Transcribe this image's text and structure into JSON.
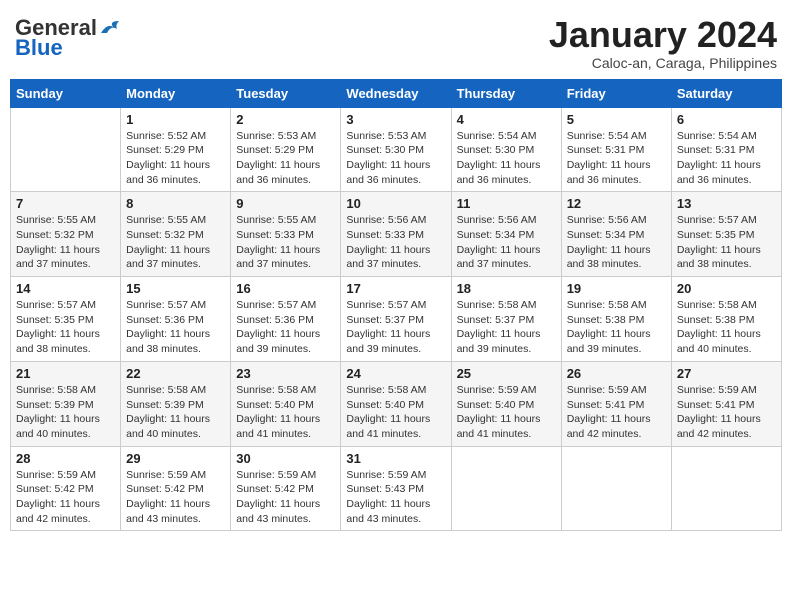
{
  "header": {
    "logo_line1": "General",
    "logo_line2": "Blue",
    "title": "January 2024",
    "subtitle": "Caloc-an, Caraga, Philippines"
  },
  "days_of_week": [
    "Sunday",
    "Monday",
    "Tuesday",
    "Wednesday",
    "Thursday",
    "Friday",
    "Saturday"
  ],
  "weeks": [
    [
      {
        "day": "",
        "info": ""
      },
      {
        "day": "1",
        "info": "Sunrise: 5:52 AM\nSunset: 5:29 PM\nDaylight: 11 hours\nand 36 minutes."
      },
      {
        "day": "2",
        "info": "Sunrise: 5:53 AM\nSunset: 5:29 PM\nDaylight: 11 hours\nand 36 minutes."
      },
      {
        "day": "3",
        "info": "Sunrise: 5:53 AM\nSunset: 5:30 PM\nDaylight: 11 hours\nand 36 minutes."
      },
      {
        "day": "4",
        "info": "Sunrise: 5:54 AM\nSunset: 5:30 PM\nDaylight: 11 hours\nand 36 minutes."
      },
      {
        "day": "5",
        "info": "Sunrise: 5:54 AM\nSunset: 5:31 PM\nDaylight: 11 hours\nand 36 minutes."
      },
      {
        "day": "6",
        "info": "Sunrise: 5:54 AM\nSunset: 5:31 PM\nDaylight: 11 hours\nand 36 minutes."
      }
    ],
    [
      {
        "day": "7",
        "info": "Sunrise: 5:55 AM\nSunset: 5:32 PM\nDaylight: 11 hours\nand 37 minutes."
      },
      {
        "day": "8",
        "info": "Sunrise: 5:55 AM\nSunset: 5:32 PM\nDaylight: 11 hours\nand 37 minutes."
      },
      {
        "day": "9",
        "info": "Sunrise: 5:55 AM\nSunset: 5:33 PM\nDaylight: 11 hours\nand 37 minutes."
      },
      {
        "day": "10",
        "info": "Sunrise: 5:56 AM\nSunset: 5:33 PM\nDaylight: 11 hours\nand 37 minutes."
      },
      {
        "day": "11",
        "info": "Sunrise: 5:56 AM\nSunset: 5:34 PM\nDaylight: 11 hours\nand 37 minutes."
      },
      {
        "day": "12",
        "info": "Sunrise: 5:56 AM\nSunset: 5:34 PM\nDaylight: 11 hours\nand 38 minutes."
      },
      {
        "day": "13",
        "info": "Sunrise: 5:57 AM\nSunset: 5:35 PM\nDaylight: 11 hours\nand 38 minutes."
      }
    ],
    [
      {
        "day": "14",
        "info": "Sunrise: 5:57 AM\nSunset: 5:35 PM\nDaylight: 11 hours\nand 38 minutes."
      },
      {
        "day": "15",
        "info": "Sunrise: 5:57 AM\nSunset: 5:36 PM\nDaylight: 11 hours\nand 38 minutes."
      },
      {
        "day": "16",
        "info": "Sunrise: 5:57 AM\nSunset: 5:36 PM\nDaylight: 11 hours\nand 39 minutes."
      },
      {
        "day": "17",
        "info": "Sunrise: 5:57 AM\nSunset: 5:37 PM\nDaylight: 11 hours\nand 39 minutes."
      },
      {
        "day": "18",
        "info": "Sunrise: 5:58 AM\nSunset: 5:37 PM\nDaylight: 11 hours\nand 39 minutes."
      },
      {
        "day": "19",
        "info": "Sunrise: 5:58 AM\nSunset: 5:38 PM\nDaylight: 11 hours\nand 39 minutes."
      },
      {
        "day": "20",
        "info": "Sunrise: 5:58 AM\nSunset: 5:38 PM\nDaylight: 11 hours\nand 40 minutes."
      }
    ],
    [
      {
        "day": "21",
        "info": "Sunrise: 5:58 AM\nSunset: 5:39 PM\nDaylight: 11 hours\nand 40 minutes."
      },
      {
        "day": "22",
        "info": "Sunrise: 5:58 AM\nSunset: 5:39 PM\nDaylight: 11 hours\nand 40 minutes."
      },
      {
        "day": "23",
        "info": "Sunrise: 5:58 AM\nSunset: 5:40 PM\nDaylight: 11 hours\nand 41 minutes."
      },
      {
        "day": "24",
        "info": "Sunrise: 5:58 AM\nSunset: 5:40 PM\nDaylight: 11 hours\nand 41 minutes."
      },
      {
        "day": "25",
        "info": "Sunrise: 5:59 AM\nSunset: 5:40 PM\nDaylight: 11 hours\nand 41 minutes."
      },
      {
        "day": "26",
        "info": "Sunrise: 5:59 AM\nSunset: 5:41 PM\nDaylight: 11 hours\nand 42 minutes."
      },
      {
        "day": "27",
        "info": "Sunrise: 5:59 AM\nSunset: 5:41 PM\nDaylight: 11 hours\nand 42 minutes."
      }
    ],
    [
      {
        "day": "28",
        "info": "Sunrise: 5:59 AM\nSunset: 5:42 PM\nDaylight: 11 hours\nand 42 minutes."
      },
      {
        "day": "29",
        "info": "Sunrise: 5:59 AM\nSunset: 5:42 PM\nDaylight: 11 hours\nand 43 minutes."
      },
      {
        "day": "30",
        "info": "Sunrise: 5:59 AM\nSunset: 5:42 PM\nDaylight: 11 hours\nand 43 minutes."
      },
      {
        "day": "31",
        "info": "Sunrise: 5:59 AM\nSunset: 5:43 PM\nDaylight: 11 hours\nand 43 minutes."
      },
      {
        "day": "",
        "info": ""
      },
      {
        "day": "",
        "info": ""
      },
      {
        "day": "",
        "info": ""
      }
    ]
  ]
}
